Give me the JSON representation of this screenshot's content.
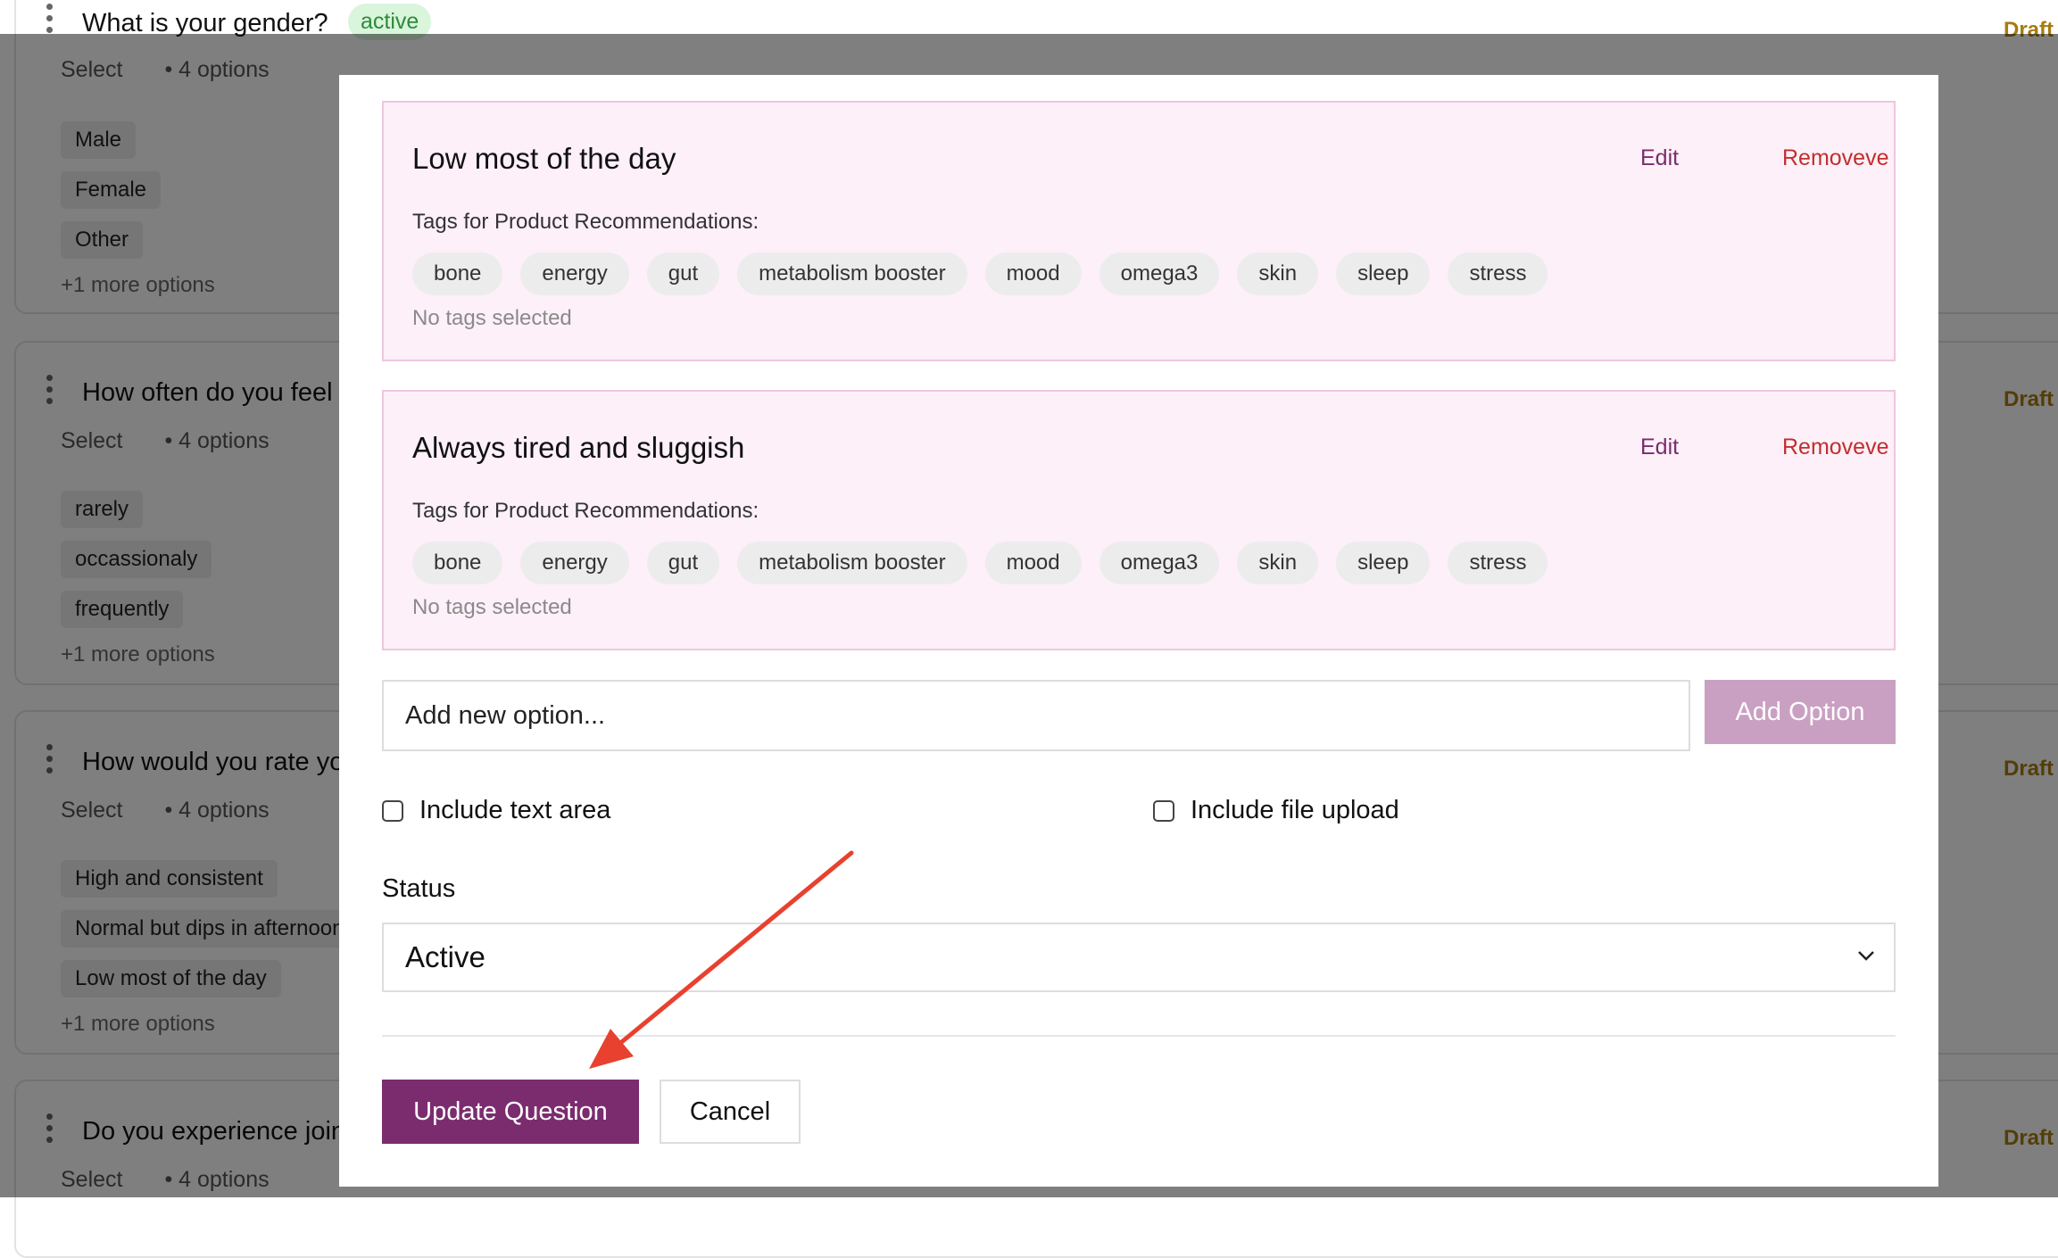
{
  "background": {
    "questions": [
      {
        "title": "What is your gender?",
        "status": "active",
        "type": "Select",
        "count": "• 4 options",
        "options": [
          "Male",
          "Female",
          "Other"
        ],
        "more": "+1 more options",
        "state": "Draft"
      },
      {
        "title": "How often do you feel r",
        "type": "Select",
        "count": "• 4 options",
        "options": [
          "rarely",
          "occassionaly",
          "frequently"
        ],
        "more": "+1 more options",
        "state": "Draft"
      },
      {
        "title": "How would you rate you",
        "type": "Select",
        "count": "• 4 options",
        "options": [
          "High and consistent",
          "Normal but dips in afternoon",
          "Low most of the day"
        ],
        "more": "+1 more options",
        "state": "Draft"
      },
      {
        "title": "Do you experience joint",
        "type": "Select",
        "count": "• 4 options",
        "state": "Draft"
      }
    ]
  },
  "modal": {
    "options": [
      {
        "title": "Low most of the day",
        "edit": "Edit",
        "remove": "Removeve",
        "tags_label": "Tags for Product Recommendations:",
        "tags": [
          "bone",
          "energy",
          "gut",
          "metabolism booster",
          "mood",
          "omega3",
          "skin",
          "sleep",
          "stress"
        ],
        "empty": "No tags selected"
      },
      {
        "title": "Always tired and sluggish",
        "edit": "Edit",
        "remove": "Removeve",
        "tags_label": "Tags for Product Recommendations:",
        "tags": [
          "bone",
          "energy",
          "gut",
          "metabolism booster",
          "mood",
          "omega3",
          "skin",
          "sleep",
          "stress"
        ],
        "empty": "No tags selected"
      }
    ],
    "new_option_placeholder": "Add new option...",
    "add_option": "Add Option",
    "include_text_area": "Include text area",
    "include_file_upload": "Include file upload",
    "status_label": "Status",
    "status_value": "Active",
    "update": "Update Question",
    "cancel": "Cancel"
  },
  "colors": {
    "primary": "#7b2c6e",
    "primary_disabled": "#c9a0c2",
    "danger": "#c22e2e",
    "option_card_bg": "#fdf0f8",
    "annotation_arrow": "#e8412f"
  }
}
